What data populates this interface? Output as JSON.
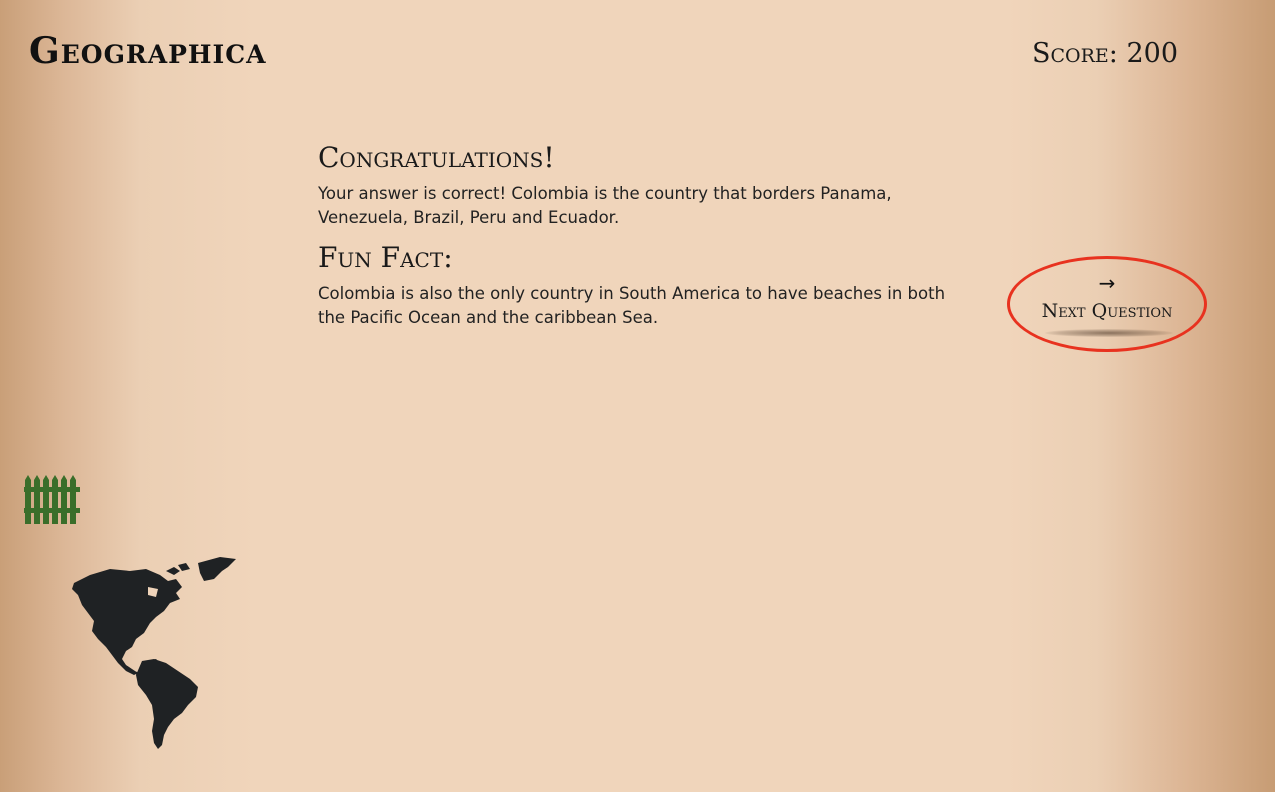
{
  "header": {
    "brand": "Geographica",
    "score_text": "Score: 200"
  },
  "result": {
    "heading": "Congratulations!",
    "message": "Your answer is correct! Colombia is the country that borders Panama, Venezuela, Brazil, Peru and Ecuador."
  },
  "fun_fact": {
    "heading": "Fun Fact:",
    "text": "Colombia is also the only country in South America to have beaches in both the Pacific Ocean and the caribbean Sea."
  },
  "next_button": {
    "icon": "arrow-right-icon",
    "label": "Next Question"
  },
  "decorations": {
    "fence_icon": "fence-icon",
    "fence_color": "#3a6e2a",
    "map_icon": "americas-map-icon",
    "map_color": "#1f2224"
  },
  "colors": {
    "background": "#f0d5bb",
    "highlight": "#e8321f"
  }
}
